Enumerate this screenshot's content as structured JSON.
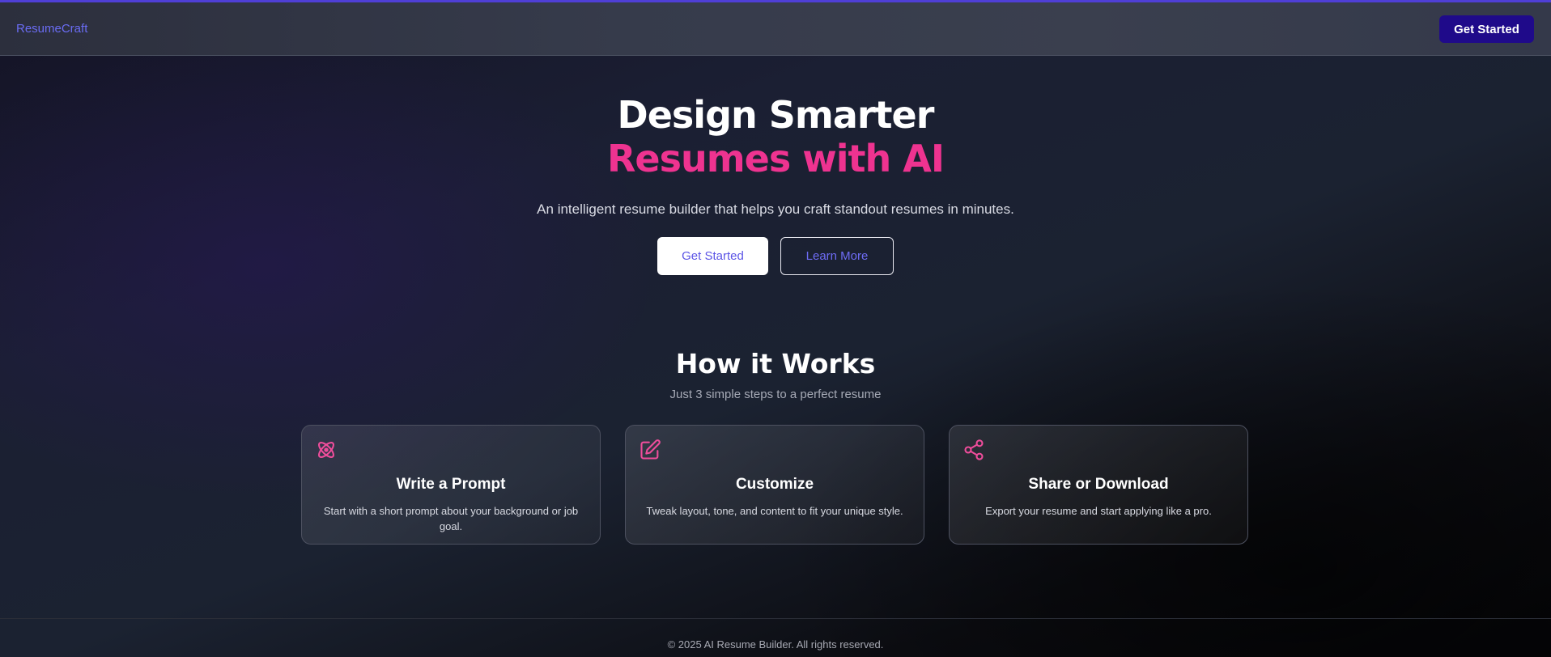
{
  "header": {
    "brand": "ResumeCraft",
    "cta_label": "Get Started"
  },
  "hero": {
    "title_line1": "Design Smarter",
    "title_line2": "Resumes with AI",
    "subtitle": "An intelligent resume builder that helps you craft standout resumes in minutes.",
    "primary_label": "Get Started",
    "secondary_label": "Learn More"
  },
  "how": {
    "title": "How it Works",
    "subtitle": "Just 3 simple steps to a perfect resume",
    "steps": [
      {
        "icon": "atom-icon",
        "title": "Write a Prompt",
        "description": "Start with a short prompt about your background or job goal."
      },
      {
        "icon": "edit-icon",
        "title": "Customize",
        "description": "Tweak layout, tone, and content to fit your unique style."
      },
      {
        "icon": "share-icon",
        "title": "Share or Download",
        "description": "Export your resume and start applying like a pro."
      }
    ]
  },
  "footer": {
    "text": "© 2025 AI Resume Builder. All rights reserved."
  },
  "colors": {
    "accent_pink": "#ee3390",
    "brand_indigo": "#6a6cf3",
    "nav_button": "#1f0a8a"
  }
}
